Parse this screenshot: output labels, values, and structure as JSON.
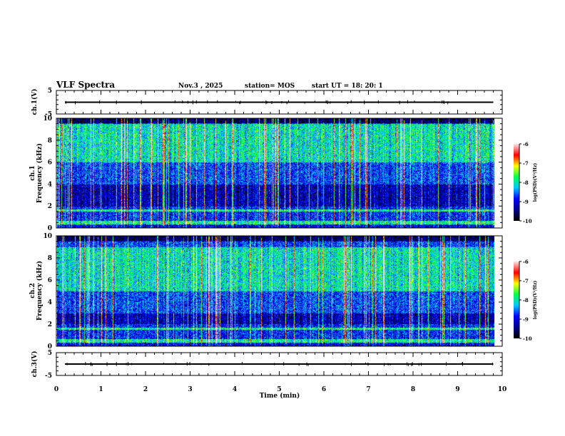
{
  "header": {
    "title": "VLF Spectra",
    "date": "Nov.3  , 2025",
    "station": "station= MOS",
    "start": "start  UT =   18: 20: 1"
  },
  "chart_data": {
    "type": "heatmap",
    "xlabel": "Time  (min)",
    "xlim": [
      0,
      10
    ],
    "xticks": [
      "0",
      "1",
      "2",
      "3",
      "4",
      "5",
      "6",
      "7",
      "8",
      "9",
      "10"
    ],
    "data_end_min": 9.8,
    "panels": [
      {
        "id": "ch1-waveform",
        "type": "line",
        "ylabel": "ch.1(V)",
        "ylim": [
          -5,
          5
        ],
        "yticks": [
          "5",
          "-5"
        ],
        "baseline": 0
      },
      {
        "id": "ch1-spectrogram",
        "type": "heatmap",
        "ylabel": "ch.1\nFrequency (kHz)",
        "ylabel_top": "ch.1",
        "ylabel_bottom": "Frequency  (kHz)",
        "ylim": [
          0,
          10
        ],
        "yticks": [
          "0",
          "2",
          "4",
          "6",
          "8",
          "10"
        ],
        "dominant_band_khz": [
          6,
          9.5
        ]
      },
      {
        "id": "ch2-spectrogram",
        "type": "heatmap",
        "ylabel_top": "ch.2",
        "ylabel_bottom": "Frequency  (kHz)",
        "ylim": [
          0,
          10
        ],
        "yticks": [
          "0",
          "2",
          "4",
          "6",
          "8",
          "10"
        ],
        "dominant_band_khz": [
          5,
          9
        ]
      },
      {
        "id": "ch3-waveform",
        "type": "line",
        "ylabel": "ch.3(V)",
        "ylim": [
          -5,
          5
        ],
        "yticks": [
          "5",
          "-5"
        ],
        "baseline": 0
      }
    ],
    "colorbar": {
      "label": "log(PSD)(V²/Hz)",
      "range": [
        -10,
        -6
      ],
      "ticks": [
        "-6",
        "-7",
        "-8",
        "-9",
        "-10"
      ],
      "colors": [
        "#000000",
        "#00008c",
        "#0000ff",
        "#00c8ff",
        "#00ff50",
        "#ffff00",
        "#ff0000",
        "#ffe0e0"
      ]
    }
  }
}
